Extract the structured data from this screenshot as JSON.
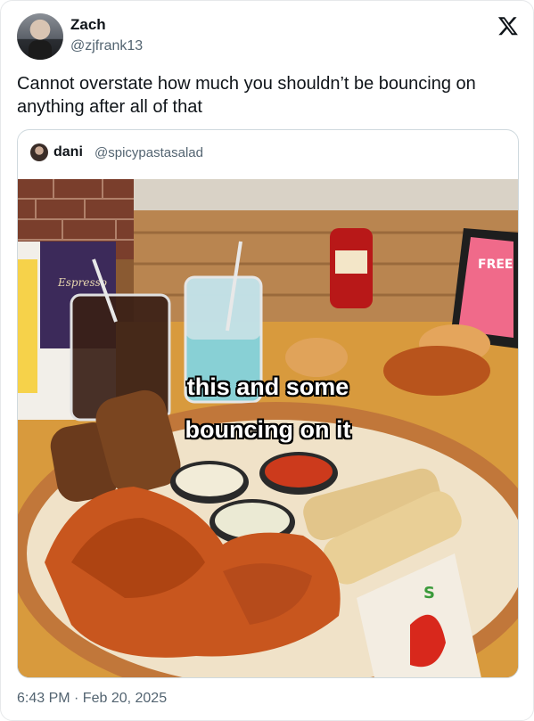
{
  "author": {
    "name": "Zach",
    "handle": "@zjfrank13"
  },
  "tweet": {
    "text": "Cannot overstate how much you shouldn’t be bouncing on anything after all of that"
  },
  "quote": {
    "author": {
      "name": "dani",
      "handle": "@spicypastasalad"
    },
    "caption_line1": "this and some",
    "caption_line2": "bouncing on it"
  },
  "timestamp": "6:43 PM · Feb 20, 2025",
  "icons": {
    "brand": "x-logo-icon"
  }
}
